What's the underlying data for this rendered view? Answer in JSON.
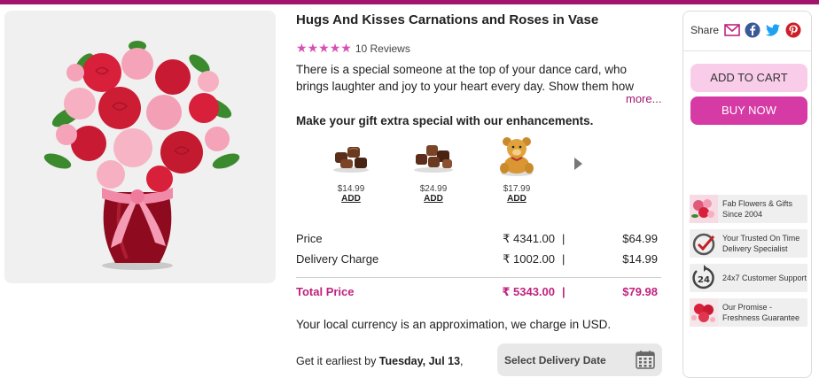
{
  "product": {
    "title": "Hugs And Kisses Carnations and Roses in Vase",
    "rating_stars": 5,
    "reviews": "10 Reviews",
    "description": "There is a special someone at the top of your dance card, who brings laughter and joy to your heart every day. Show them how",
    "more_label": "more..."
  },
  "enhancements": {
    "heading": "Make your gift extra special with our enhancements.",
    "items": [
      {
        "icon": "chocolates-icon",
        "price": "$14.99",
        "add_label": "ADD"
      },
      {
        "icon": "chocolates-box-icon",
        "price": "$24.99",
        "add_label": "ADD"
      },
      {
        "icon": "teddy-bear-icon",
        "price": "$17.99",
        "add_label": "ADD"
      }
    ]
  },
  "pricing": {
    "rows": [
      {
        "label": "Price",
        "inr": "₹ 4341.00",
        "sep": "|",
        "usd": "$64.99"
      },
      {
        "label": "Delivery Charge",
        "inr": "₹ 1002.00",
        "sep": "|",
        "usd": "$14.99"
      }
    ],
    "total": {
      "label": "Total Price",
      "inr": "₹ 5343.00",
      "sep": "|",
      "usd": "$79.98"
    },
    "currency_note": "Your local currency is an approximation, we charge in USD."
  },
  "delivery": {
    "earliest_prefix": "Get it earliest by",
    "earliest_date": "Tuesday, Jul 13",
    "earliest_suffix": ",",
    "select_label": "Select Delivery Date"
  },
  "side": {
    "share_label": "Share",
    "add_to_cart": "ADD TO CART",
    "buy_now": "BUY NOW",
    "usps": [
      "Fab Flowers & Gifts Since 2004",
      "Your Trusted On Time Delivery Specialist",
      "24x7 Customer Support",
      "Our Promise - Freshness Guarantee"
    ]
  },
  "colors": {
    "brand": "#a3146f",
    "accent_pink": "#d63aa4",
    "light_pink": "#f9cdea",
    "total_color": "#c0237e"
  }
}
